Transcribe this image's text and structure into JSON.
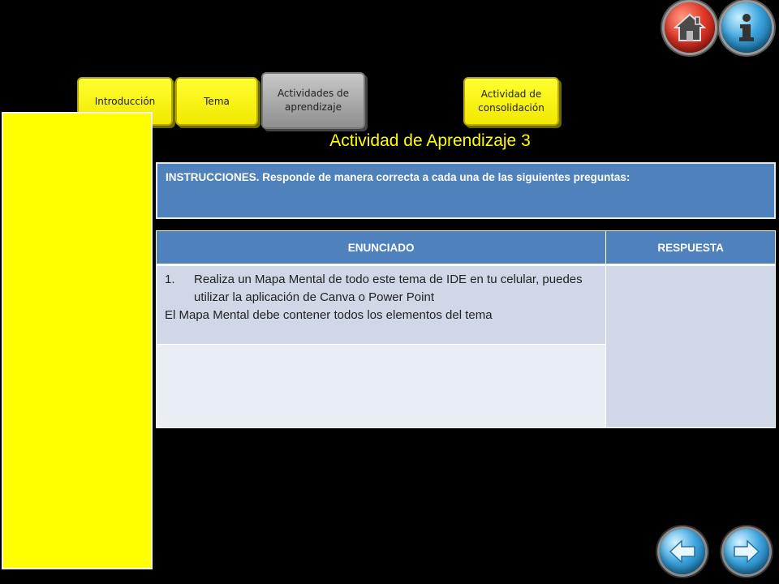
{
  "header_buttons": {
    "home_icon": "home-icon",
    "info_icon": "info-icon"
  },
  "tabs": [
    {
      "label": "Introducción",
      "state": "active-yellow"
    },
    {
      "label": "Tema",
      "state": "active-yellow"
    },
    {
      "label": "Actividades de aprendizaje",
      "state": "selected-grey"
    },
    {
      "label": "Actividad de consolidación",
      "state": "active-yellow"
    }
  ],
  "heading": "Actividad de Aprendizaje 3",
  "instructions": "INSTRUCCIONES. Responde de manera correcta a cada una de las siguientes preguntas:",
  "table": {
    "headers": [
      "ENUNCIADO",
      "RESPUESTA"
    ],
    "question_number": "1.",
    "question_text": "Realiza un Mapa Mental de todo este tema de IDE  en tu celular, puedes utilizar la aplicación de Canva o Power Point",
    "question_note": "El Mapa Mental  debe contener todos los elementos del tema"
  },
  "colors": {
    "background": "#000000",
    "accent_yellow": "#ffff00",
    "table_header_blue": "#4f81bd",
    "table_cell": "#d0d8e8"
  },
  "nav": {
    "prev_icon": "arrow-left-icon",
    "next_icon": "arrow-right-icon"
  }
}
